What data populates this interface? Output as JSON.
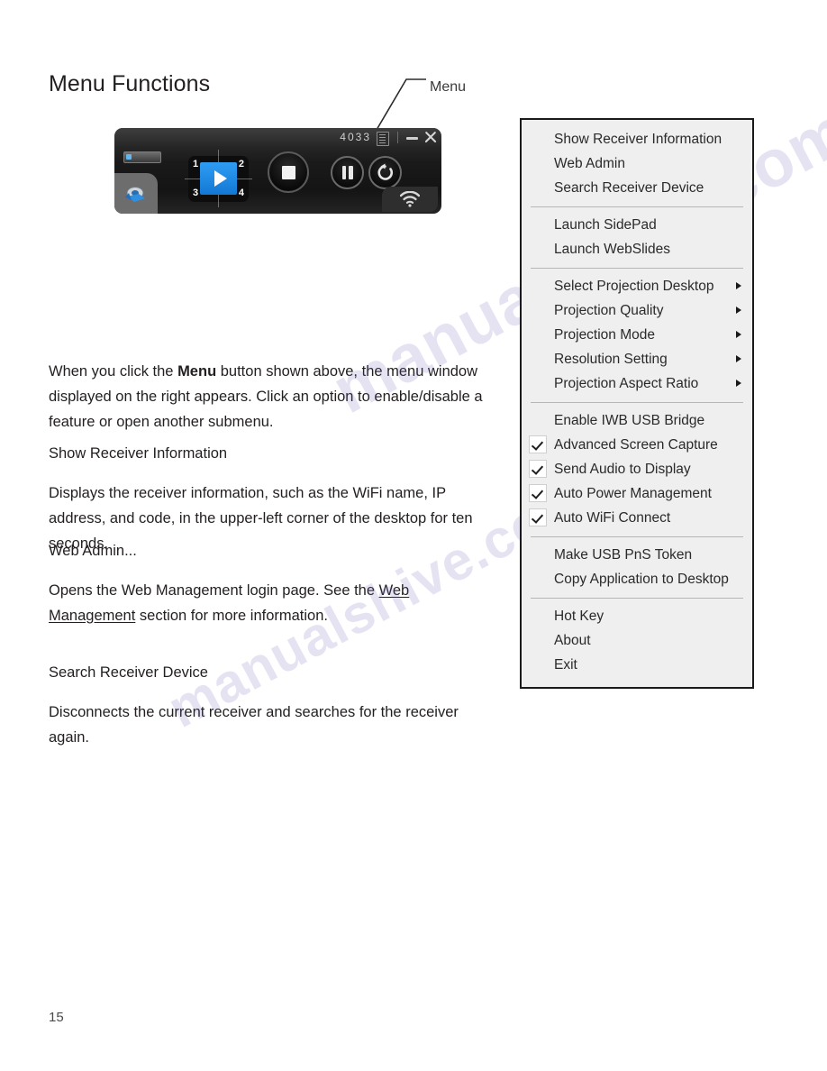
{
  "page": {
    "title": "Menu Functions",
    "number": "15",
    "watermark_1": "manualshive.com",
    "watermark_2": "manualshive.com"
  },
  "callout": {
    "label": "Menu",
    "icon": "leader-line"
  },
  "toolbar": {
    "code": "4033",
    "menu_icon": "menu-list-icon",
    "minimize_label": "–",
    "close_label": "✕",
    "device_icon": "projector-icon",
    "tab_icon": "app-logo-icon",
    "quadrants": [
      "1",
      "2",
      "3",
      "4"
    ],
    "play_icon": "play-icon",
    "stop_icon": "stop-icon",
    "pause_icon": "pause-icon",
    "refresh_icon": "refresh-icon",
    "wifi_icon": "wifi-icon"
  },
  "body": {
    "intro_before": "When you click the ",
    "intro_bold": "Menu",
    "intro_after": " button shown above, the menu window displayed on the right appears. Click an option to enable/disable a feature or open another submenu.",
    "sections": [
      {
        "heading": "Show Receiver Information",
        "text": "Displays the receiver information, such as the WiFi name, IP address, and code, in the upper-left corner of the desktop for ten seconds."
      },
      {
        "heading": "Web Admin...",
        "text_before": "Opens the Web Management login page. See the ",
        "link": "Web Management",
        "text_after": " section for more information."
      },
      {
        "heading": "Search Receiver Device",
        "text": "Disconnects the current receiver and searches for the receiver again."
      }
    ]
  },
  "menu": {
    "groups": [
      {
        "items": [
          {
            "label": "Show Receiver Information",
            "submenu": false,
            "checkbox": false
          },
          {
            "label": "Web Admin",
            "submenu": false,
            "checkbox": false
          },
          {
            "label": "Search Receiver Device",
            "submenu": false,
            "checkbox": false
          }
        ]
      },
      {
        "items": [
          {
            "label": "Launch SidePad",
            "submenu": false,
            "checkbox": false
          },
          {
            "label": "Launch WebSlides",
            "submenu": false,
            "checkbox": false
          }
        ]
      },
      {
        "items": [
          {
            "label": "Select Projection Desktop",
            "submenu": true,
            "checkbox": false
          },
          {
            "label": "Projection Quality",
            "submenu": true,
            "checkbox": false
          },
          {
            "label": "Projection Mode",
            "submenu": true,
            "checkbox": false
          },
          {
            "label": "Resolution Setting",
            "submenu": true,
            "checkbox": false
          },
          {
            "label": "Projection Aspect Ratio",
            "submenu": true,
            "checkbox": false
          }
        ]
      },
      {
        "items": [
          {
            "label": "Enable IWB USB Bridge",
            "submenu": false,
            "checkbox": false,
            "checked": false
          },
          {
            "label": "Advanced Screen Capture",
            "submenu": false,
            "checkbox": true,
            "checked": true
          },
          {
            "label": "Send Audio to Display",
            "submenu": false,
            "checkbox": true,
            "checked": true
          },
          {
            "label": "Auto Power Management",
            "submenu": false,
            "checkbox": true,
            "checked": true
          },
          {
            "label": "Auto WiFi Connect",
            "submenu": false,
            "checkbox": true,
            "checked": true
          }
        ]
      },
      {
        "items": [
          {
            "label": "Make USB PnS Token",
            "submenu": false,
            "checkbox": false
          },
          {
            "label": "Copy Application to Desktop",
            "submenu": false,
            "checkbox": false
          }
        ]
      },
      {
        "items": [
          {
            "label": "Hot Key",
            "submenu": false,
            "checkbox": false
          },
          {
            "label": "About",
            "submenu": false,
            "checkbox": false
          },
          {
            "label": "Exit",
            "submenu": false,
            "checkbox": false
          }
        ]
      }
    ]
  },
  "colors": {
    "accent_blue": "#1e86e8",
    "menu_bg": "#efefef",
    "menu_border": "#1a1a1a",
    "text": "#231f20",
    "watermark": "#6b61b5"
  }
}
